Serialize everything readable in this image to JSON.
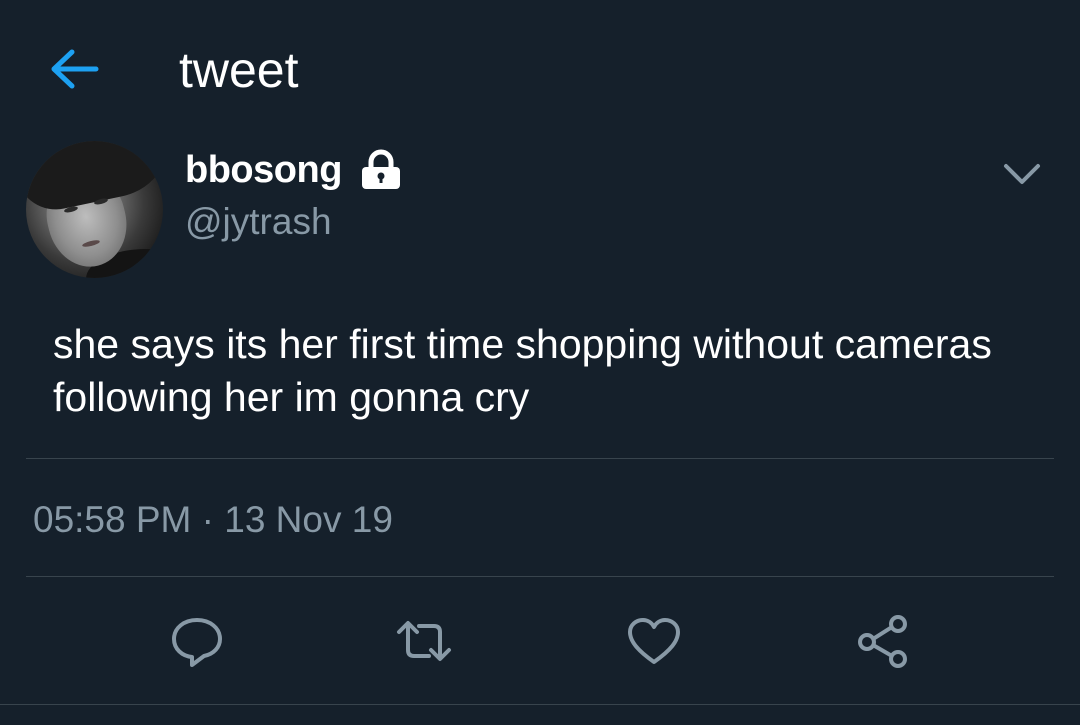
{
  "header": {
    "title": "tweet",
    "back_icon": "arrow-left-icon",
    "accent_color": "#1da1f2"
  },
  "tweet": {
    "display_name": "bbosong",
    "username": "@jytrash",
    "protected_icon": "lock-icon",
    "text": "she says its her first time shopping without cameras following her im gonna cry",
    "timestamp": "05:58 PM · 13 Nov 19"
  },
  "actions": [
    {
      "icon": "reply-icon"
    },
    {
      "icon": "retweet-icon"
    },
    {
      "icon": "like-icon"
    },
    {
      "icon": "share-icon"
    }
  ],
  "colors": {
    "background": "#15202b",
    "secondary_text": "#8899a6",
    "divider": "#38444d"
  }
}
